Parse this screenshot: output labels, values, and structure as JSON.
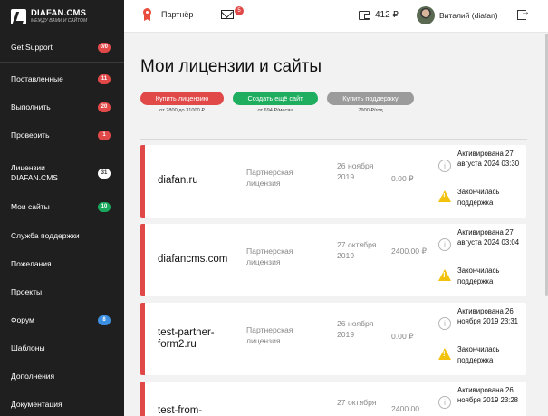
{
  "logo": {
    "name": "DIAFAN.CMS",
    "tagline": "МЕЖДУ ВАМИ И САЙТОМ"
  },
  "sidebar": {
    "items": [
      {
        "label": "Get Support",
        "badge": "0/0",
        "badge_color": "red"
      },
      {
        "label": "Поставленные",
        "badge": "11",
        "badge_color": "red"
      },
      {
        "label": "Выполнить",
        "badge": "20",
        "badge_color": "red"
      },
      {
        "label": "Проверить",
        "badge": "1",
        "badge_color": "red"
      },
      {
        "label": "Лицензии DIAFAN.CMS",
        "badge": "31",
        "badge_color": "white"
      },
      {
        "label": "Мои сайты",
        "badge": "10",
        "badge_color": "green"
      },
      {
        "label": "Служба поддержки",
        "badge": "",
        "badge_color": ""
      },
      {
        "label": "Пожелания",
        "badge": "",
        "badge_color": ""
      },
      {
        "label": "Проекты",
        "badge": "",
        "badge_color": ""
      },
      {
        "label": "Форум",
        "badge": "8",
        "badge_color": "blue"
      },
      {
        "label": "Шаблоны",
        "badge": "",
        "badge_color": ""
      },
      {
        "label": "Дополнения",
        "badge": "",
        "badge_color": ""
      },
      {
        "label": "Документация",
        "badge": "",
        "badge_color": ""
      }
    ]
  },
  "header": {
    "partner_label": "Партнёр",
    "mail_count": "5",
    "balance": "412 ₽",
    "user_name": "Виталий (diafan)"
  },
  "main": {
    "title": "Мои лицензии и сайты",
    "actions": [
      {
        "label": "Купить лицензию",
        "sub": "от 2800 до 31000 ₽",
        "color": "#e14848"
      },
      {
        "label": "Создать ещё сайт",
        "sub": "от 694 ₽/месяц",
        "color": "#1fae5f"
      },
      {
        "label": "Купить поддержку",
        "sub": "7900 ₽/год",
        "color": "#9b9b9b"
      }
    ],
    "licenses": [
      {
        "domain": "diafan.ru",
        "type": "Партнерская лицензия",
        "date": "26 ноября 2019",
        "price": "0.00 ₽",
        "activated": "Активирована 27 августа 2024 03:30",
        "support": "Закончилась поддержка"
      },
      {
        "domain": "diafancms.com",
        "type": "Партнерская лицензия",
        "date": "27 октября 2019",
        "price": "2400.00 ₽",
        "activated": "Активирована 27 августа 2024 03:04",
        "support": "Закончилась поддержка"
      },
      {
        "domain": "test-partner-form2.ru",
        "type": "Партнерская лицензия",
        "date": "26 ноября 2019",
        "price": "0.00 ₽",
        "activated": "Активирована 26 ноября 2019 23:31",
        "support": "Закончилась поддержка"
      },
      {
        "domain": "test-from-",
        "type": "",
        "date": "27 октября",
        "price": "2400.00",
        "activated": "Активирована 26 ноября 2019 23:28",
        "support": ""
      }
    ]
  }
}
